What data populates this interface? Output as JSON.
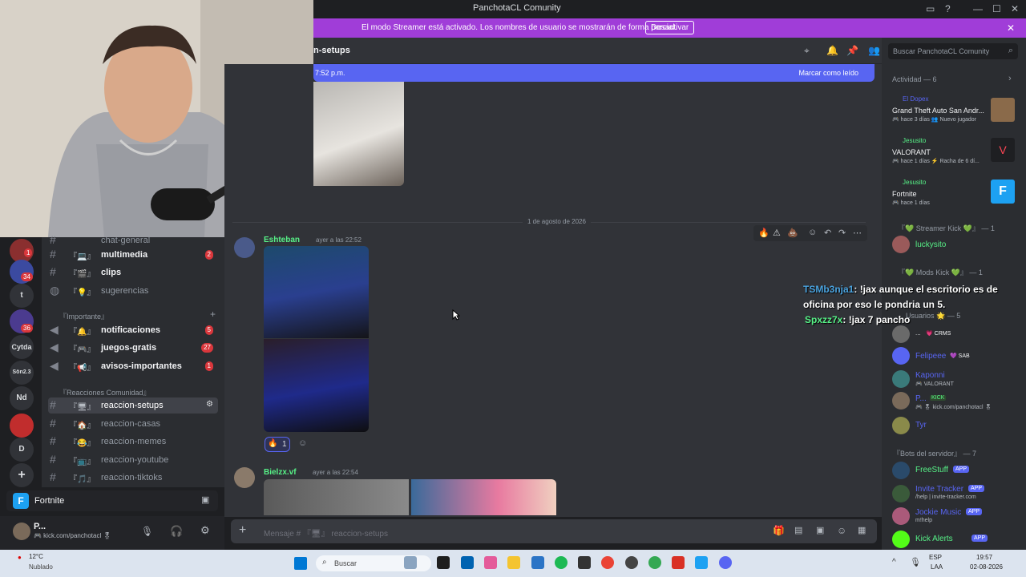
{
  "window": {
    "title": "PanchotaCL Comunity"
  },
  "banner": {
    "message": "El modo Streamer está activado. Los nombres de usuario se mostrarán de forma parcial.",
    "button": "Desactivar"
  },
  "channel_header": {
    "name": "n-setups"
  },
  "search": {
    "placeholder": "Buscar PanchotaCL Comunity"
  },
  "new_messages": {
    "time": "7:52 p.m.",
    "mark_read": "Marcar como leído"
  },
  "rail": {
    "badges": [
      "1",
      "34",
      "36"
    ],
    "labels": [
      "t",
      "Cytda",
      "Sön2.3",
      "Nd",
      "D"
    ]
  },
  "channels": {
    "top": {
      "name": "chat-general"
    },
    "items": [
      {
        "emoji": "『💻』",
        "name": "multimedia",
        "count": "2"
      },
      {
        "emoji": "『🎬』",
        "name": "clips"
      },
      {
        "emoji": "『💡』",
        "name": "sugerencias"
      }
    ],
    "category_important": "『Importante』",
    "important": [
      {
        "emoji": "『🔔』",
        "name": "notificaciones",
        "count": "5"
      },
      {
        "emoji": "『🎮』",
        "name": "juegos-gratis",
        "count": "27"
      },
      {
        "emoji": "『📢』",
        "name": "avisos-importantes",
        "count": "1"
      }
    ],
    "category_reactions": "『Reacciones Comunidad』",
    "reactions": [
      {
        "emoji": "『🖥』",
        "name": "reaccion-setups"
      },
      {
        "emoji": "『🏠』",
        "name": "reaccion-casas"
      },
      {
        "emoji": "『😂』",
        "name": "reaccion-memes"
      },
      {
        "emoji": "『📺』",
        "name": "reaccion-youtube"
      },
      {
        "emoji": "『🎵』",
        "name": "reaccion-tiktoks"
      }
    ]
  },
  "voice": {
    "activity": "Fortnite"
  },
  "user": {
    "name": "P...",
    "status": "🎮 kick.com/panchotacl 🎖"
  },
  "chat": {
    "date_divider": "1 de agosto de 2026",
    "messages": [
      {
        "author": "Eshteban",
        "time": "ayer a las 22:52",
        "reaction_emoji": "🔥",
        "reaction_count": "1"
      },
      {
        "author": "Bielzx.vf",
        "time": "ayer a las 22:54"
      }
    ]
  },
  "composer": {
    "placeholder": "Mensaje # 『🖥』 reaccion-setups"
  },
  "activity": {
    "header": "Actividad — 6",
    "items": [
      {
        "user": "El Dopex",
        "game": "Grand Theft Auto San Andr...",
        "meta": "🎮 hace 3 días  👥 Nuevo jugador"
      },
      {
        "user": "Jesusito",
        "game": "VALORANT",
        "meta": "🎮 hace 1 días  ⚡ Racha de 6 dí..."
      },
      {
        "user": "Jesusito",
        "game": "Fortnite",
        "meta": "🎮 hace 1 días"
      }
    ]
  },
  "members": {
    "groups": [
      {
        "label": "『💚 Streamer Kick 💚』 — 1"
      },
      {
        "label": "『💚 Mods Kick 💚』 — 1"
      },
      {
        "label": "Usuarios 🌟 — 5"
      },
      {
        "label": "『Bots del servidor』 — 7"
      }
    ],
    "list": [
      {
        "name": "luckysito",
        "sub": ""
      },
      {
        "name": "...",
        "sub": "💗 CRMS"
      },
      {
        "name": "Felipeee",
        "sub": "💜 SAB"
      },
      {
        "name": "Kaponni",
        "sub": "🎮 VALORANT"
      },
      {
        "name": "P...",
        "sub": "🎮 🎖 kick.com/panchotacl 🎖"
      },
      {
        "name": "Tyr",
        "sub": ""
      },
      {
        "name": "FreeStuff",
        "sub": ""
      },
      {
        "name": "Invite Tracker",
        "sub": "/help | invite-tracker.com"
      },
      {
        "name": "Jockie Music",
        "sub": "m!help"
      },
      {
        "name": "Kick Alerts",
        "sub": ""
      }
    ],
    "app_tag": "APP",
    "kick_tag": "KICK"
  },
  "overlay_chat": [
    {
      "user": "TSMb3nja1",
      "text": ": !jax aunque el escritorio es de oficina por eso le pondria un 5."
    },
    {
      "user": "Spxzz7x",
      "text": ": !jax 7 pancho"
    }
  ],
  "taskbar": {
    "weather_temp": "12°C",
    "weather_desc": "Nublado",
    "search": "Buscar",
    "lang": "ESP",
    "lang_sub": "LAA",
    "time": "19:57",
    "date": "02-08-2026"
  },
  "colors": {
    "accent": "#5865f2",
    "streamer": "#a03dd8",
    "green": "#57f287"
  }
}
